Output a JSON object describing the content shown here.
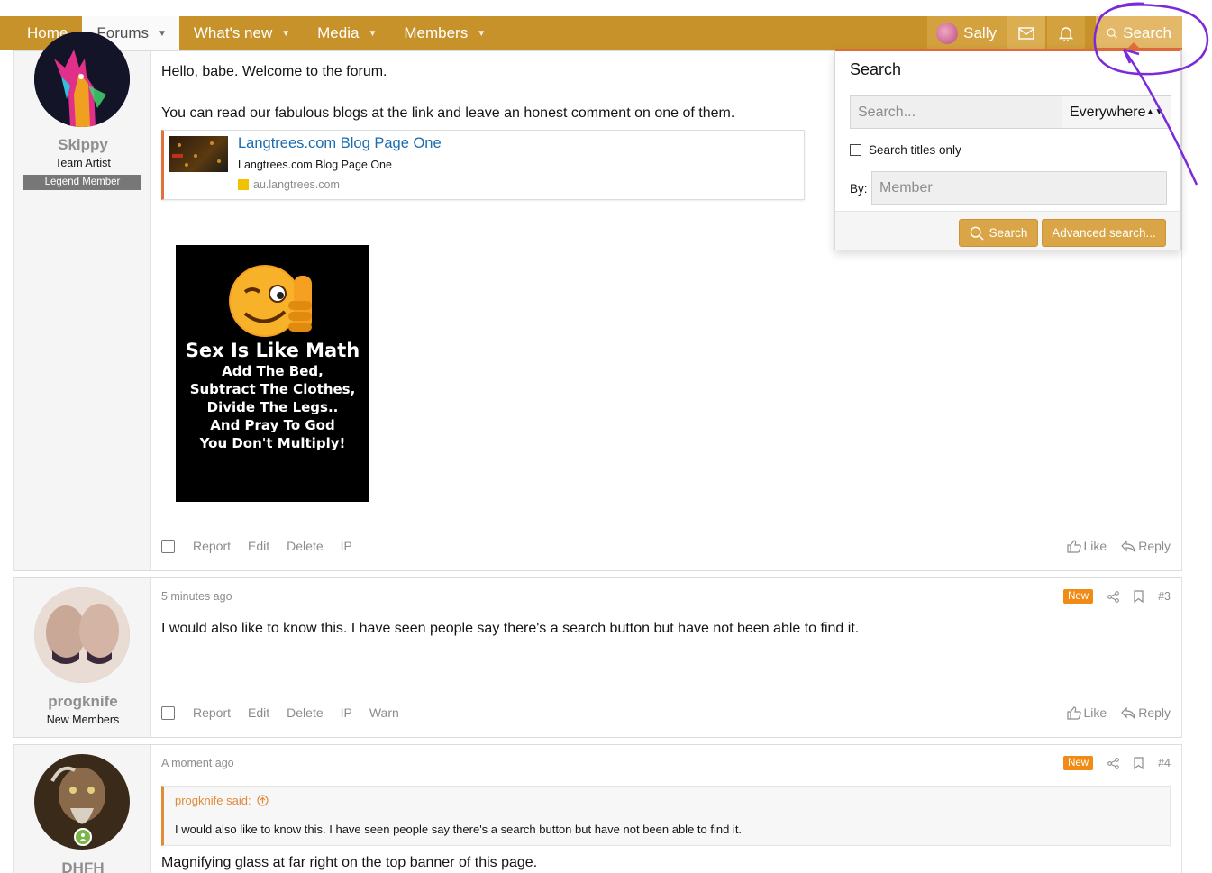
{
  "nav": {
    "home": "Home",
    "forums": "Forums",
    "whats_new": "What's new",
    "media": "Media",
    "members": "Members",
    "user": "Sally",
    "search": "Search"
  },
  "posts": [
    {
      "username": "Skippy",
      "usertitle": "Team Artist",
      "banner": "Legend Member",
      "text1": "Hello, babe. Welcome to the forum.",
      "text2": "You can read our fabulous blogs at the link and leave an honest comment on one of them.",
      "unfurl": {
        "title": "Langtrees.com Blog Page One",
        "desc": "Langtrees.com Blog Page One",
        "domain": "au.langtrees.com"
      },
      "meme": {
        "line1": "Sex Is Like Math",
        "line2": "Add The Bed,",
        "line3": "Subtract The Clothes,",
        "line4": "Divide The Legs..",
        "line5": "And Pray To God",
        "line6": "You Don't Multiply!"
      },
      "actions": [
        "Report",
        "Edit",
        "Delete",
        "IP"
      ],
      "like": "Like",
      "reply": "Reply"
    },
    {
      "username": "progknife",
      "usertitle": "New Members",
      "time": "5 minutes ago",
      "badge": "New",
      "num": "#3",
      "text": "I would also like to know this. I have seen people say there's a search button but have not been able to find it.",
      "actions": [
        "Report",
        "Edit",
        "Delete",
        "IP",
        "Warn"
      ],
      "like": "Like",
      "reply": "Reply"
    },
    {
      "username": "DHFH",
      "time": "A moment ago",
      "badge": "New",
      "num": "#4",
      "quote_author": "progknife said:",
      "quote_text": "I would also like to know this. I have seen people say there's a search button but have not been able to find it.",
      "text": "Magnifying glass at far right on the top banner of this page."
    }
  ],
  "search_menu": {
    "title": "Search",
    "placeholder": "Search...",
    "scope": "Everywhere",
    "titles_only": "Search titles only",
    "by_label": "By:",
    "member_placeholder": "Member",
    "search_btn": "Search",
    "advanced_btn": "Advanced search..."
  },
  "colors": {
    "nav_bg": "#c8922a",
    "accent": "#e06b3a",
    "link": "#1a6cb0",
    "badge_new": "#f08b16",
    "annotation": "#7a2ad8"
  }
}
